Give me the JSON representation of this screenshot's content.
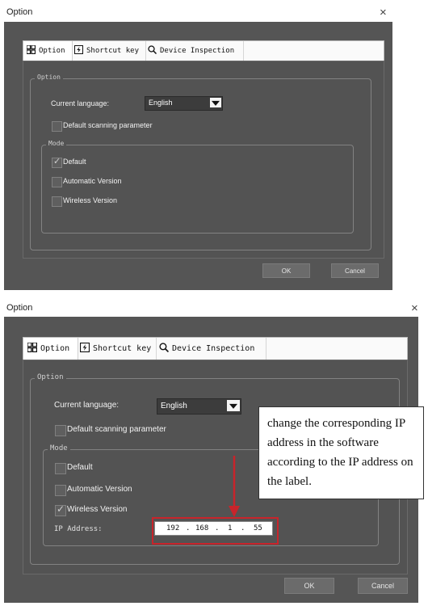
{
  "top": {
    "window_title": "Option",
    "close_glyph": "×",
    "tabs": [
      {
        "icon": "grid-icon",
        "label": "Option"
      },
      {
        "icon": "lightning-icon",
        "label": "Shortcut key"
      },
      {
        "icon": "search-icon",
        "label": "Device Inspection"
      }
    ],
    "group_option": "Option",
    "current_language_label": "Current language:",
    "language_value": "English",
    "default_scanning_label": "Default scanning parameter",
    "default_scanning_checked": false,
    "group_mode": "Mode",
    "modes": [
      {
        "label": "Default",
        "checked": true
      },
      {
        "label": "Automatic Version",
        "checked": false
      },
      {
        "label": "Wireless Version",
        "checked": false
      }
    ],
    "ok_label": "OK",
    "cancel_label": "Cancel"
  },
  "bottom": {
    "window_title": "Option",
    "close_glyph": "×",
    "tabs": [
      {
        "icon": "grid-icon",
        "label": "Option"
      },
      {
        "icon": "lightning-icon",
        "label": "Shortcut key"
      },
      {
        "icon": "search-icon",
        "label": "Device Inspection"
      }
    ],
    "group_option": "Option",
    "current_language_label": "Current language:",
    "language_value": "English",
    "default_scanning_label": "Default scanning parameter",
    "default_scanning_checked": false,
    "group_mode": "Mode",
    "modes": [
      {
        "label": "Default",
        "checked": false
      },
      {
        "label": "Automatic Version",
        "checked": false
      },
      {
        "label": "Wireless Version",
        "checked": true
      }
    ],
    "ip_label": "IP Address:",
    "ip_octets": [
      "192",
      "168",
      "1",
      "55"
    ],
    "ip_dot": ".",
    "ok_label": "OK",
    "cancel_label": "Cancel",
    "callout_text": "change the corresponding IP address in the software according to the IP address on the label.",
    "annotation_color": "#c8242b"
  }
}
